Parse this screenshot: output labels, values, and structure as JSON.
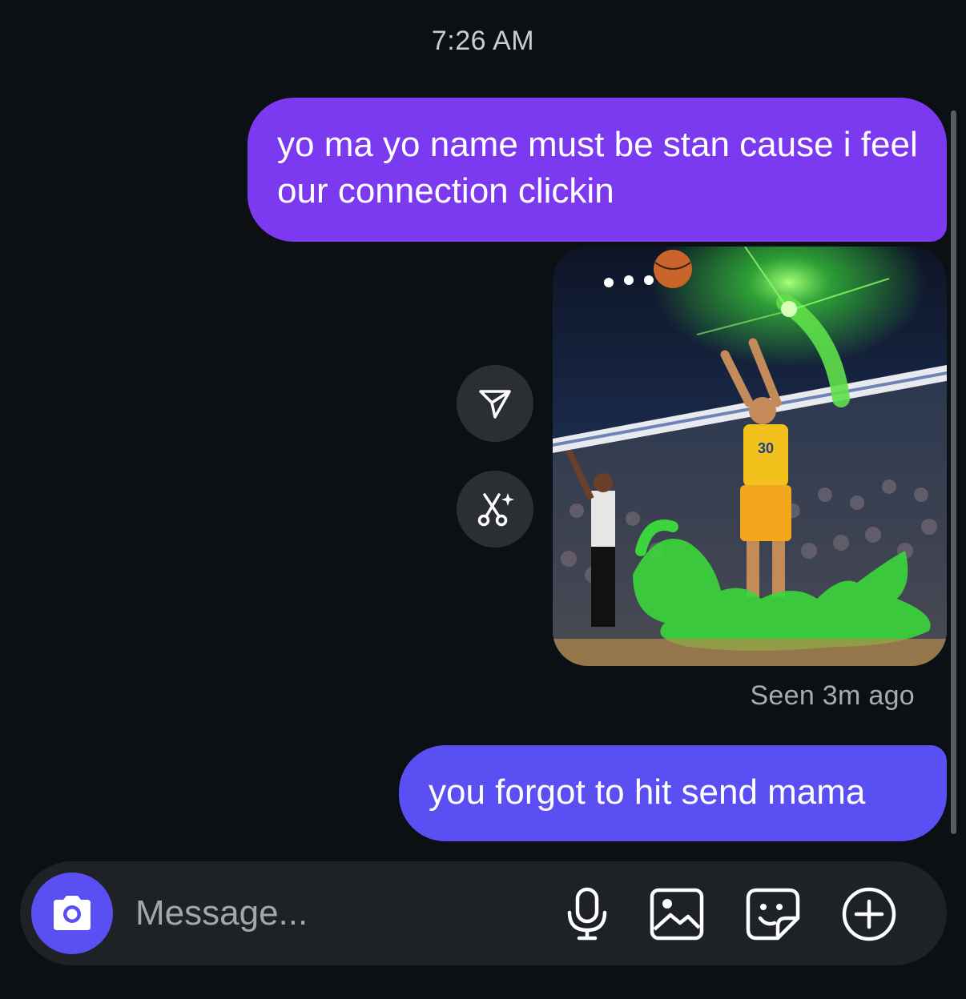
{
  "status": {
    "time": "7:26 AM"
  },
  "messages": [
    {
      "type": "text",
      "sender": "me",
      "text": "yo ma yo name must be stan cause i feel our connection clickin",
      "color": "#7c3af0"
    },
    {
      "type": "image",
      "sender": "me",
      "icon": "basketball-player-photo"
    },
    {
      "type": "text",
      "sender": "me",
      "text": "you forgot to hit send mama",
      "color": "#5a4ff2"
    }
  ],
  "image_actions": {
    "share_icon": "send-icon",
    "cut_icon": "scissors-sparkle-icon"
  },
  "read_receipt": "Seen 3m ago",
  "composer": {
    "placeholder": "Message...",
    "camera_icon": "camera-icon",
    "tools": [
      "mic-icon",
      "gallery-icon",
      "sticker-icon",
      "plus-circle-icon"
    ],
    "accent": "#5a4ff2"
  },
  "photo": {
    "jersey_number": "30"
  }
}
